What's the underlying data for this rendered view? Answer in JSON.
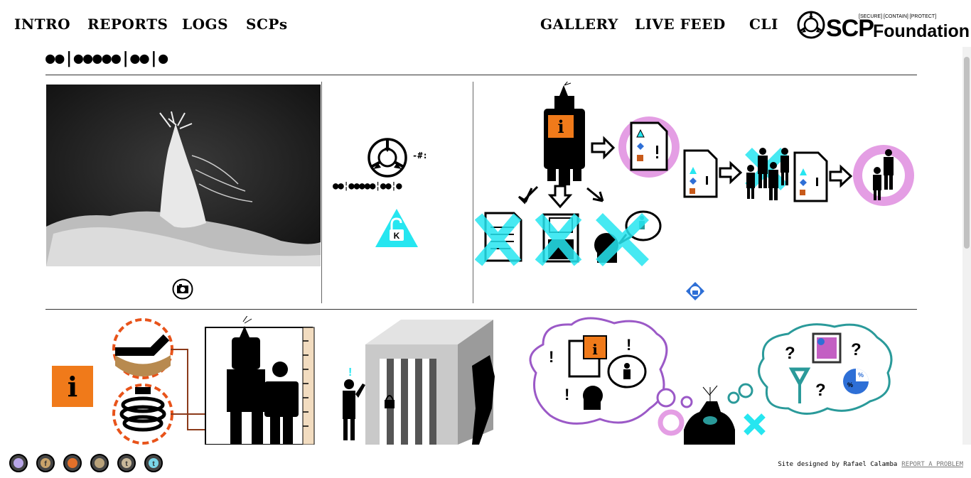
{
  "nav": {
    "left": [
      "INTRO",
      "REPORTS",
      "LOGS",
      "SCPs"
    ],
    "right": [
      "GALLERY",
      "LIVE FEED",
      "CLI"
    ]
  },
  "logo": {
    "tagline": "[SECURE] [CONTAIN] [PROTECT]",
    "wordmark_scp": "SCP",
    "wordmark_foundation": "Foundation"
  },
  "header": {
    "redacted_title": "●●|●●●●●|●●|●"
  },
  "object_class": {
    "code": "-#:",
    "redacted_designation": "●●¦●●●●●¦●●¦●",
    "level_letter": "K"
  },
  "flow": {
    "info_glyph": "i"
  },
  "bottom": {
    "info_glyph": "i",
    "exclaim": "!",
    "question": "?",
    "percent": "%"
  },
  "footer": {
    "credit": "Site designed by Rafael Calamba",
    "report_link": "REPORT A PROBLEM",
    "social_icons": [
      "site-icon",
      "facebook-icon",
      "reddit-icon",
      "scp-icon",
      "tumblr-icon",
      "twitter-icon"
    ]
  },
  "colors": {
    "accent_orange": "#f07a1a",
    "accent_cyan": "#26e6f0",
    "accent_pink": "#e49ee4",
    "accent_purple": "#9b59c7",
    "accent_teal": "#2a9a9a",
    "accent_blue": "#2e6fd6"
  }
}
